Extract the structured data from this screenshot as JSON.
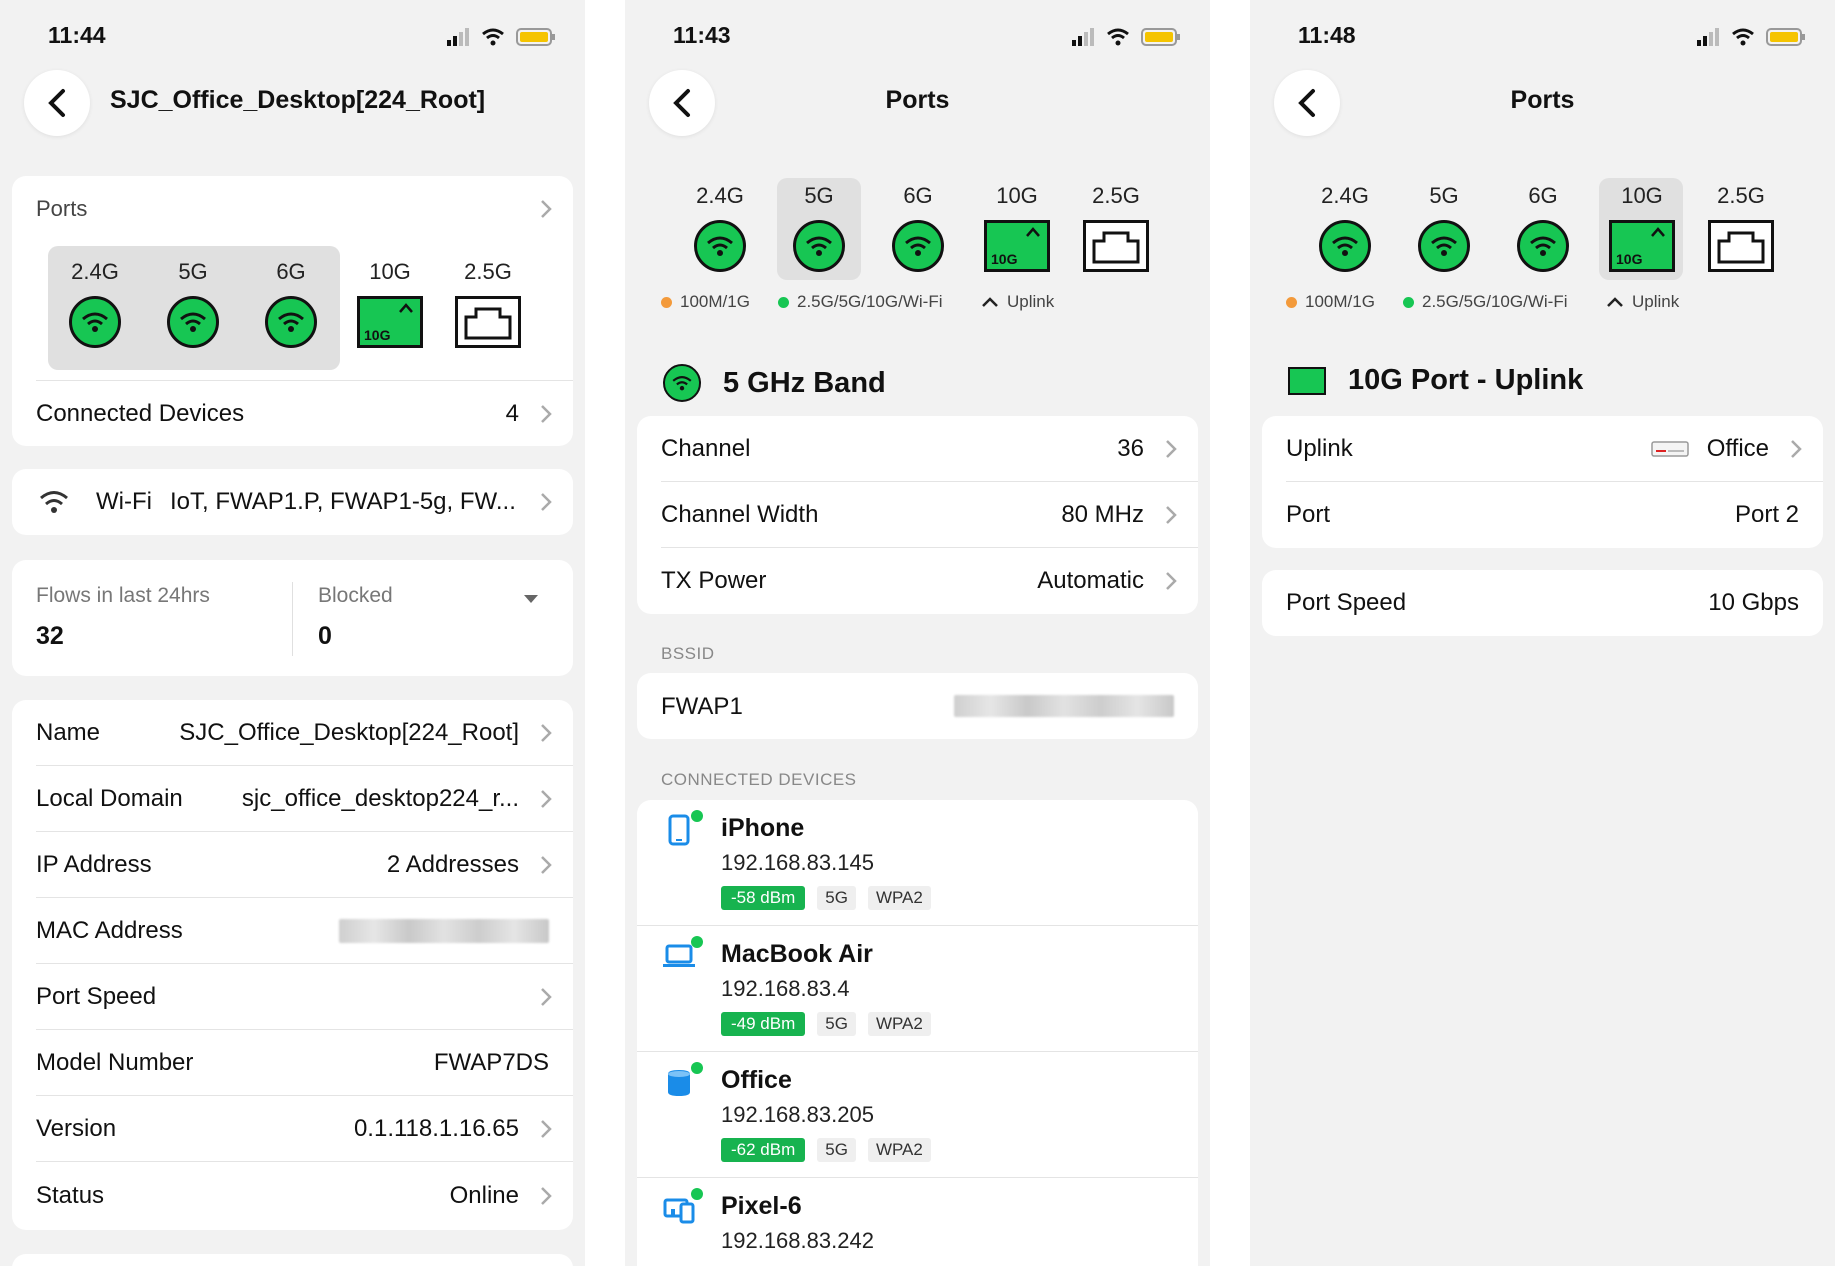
{
  "screen1": {
    "time": "11:44",
    "title": "SJC_Office_Desktop[224_Root]",
    "ports": {
      "label": "Ports",
      "items": [
        "2.4G",
        "5G",
        "6G",
        "10G",
        "2.5G"
      ],
      "badge_10g": "10G"
    },
    "connected_devices": {
      "label": "Connected Devices",
      "value": "4"
    },
    "wifi": {
      "label": "Wi-Fi",
      "value": "IoT, FWAP1.P, FWAP1-5g, FW..."
    },
    "flows": {
      "label": "Flows in last 24hrs",
      "value": "32"
    },
    "blocked": {
      "label": "Blocked",
      "value": "0"
    },
    "details": [
      {
        "label": "Name",
        "value": "SJC_Office_Desktop[224_Root]"
      },
      {
        "label": "Local Domain",
        "value": "sjc_office_desktop224_r..."
      },
      {
        "label": "IP Address",
        "value": "2 Addresses"
      },
      {
        "label": "MAC Address",
        "value": ""
      },
      {
        "label": "Port Speed",
        "value": ""
      },
      {
        "label": "Model Number",
        "value": "FWAP7DS"
      },
      {
        "label": "Version",
        "value": "0.1.118.1.16.65"
      },
      {
        "label": "Status",
        "value": "Online"
      }
    ]
  },
  "screen2": {
    "time": "11:43",
    "title": "Ports",
    "ports": [
      "2.4G",
      "5G",
      "6G",
      "10G",
      "2.5G"
    ],
    "badge_10g": "10G",
    "legend": [
      "100M/1G",
      "2.5G/5G/10G/Wi-Fi",
      "Uplink"
    ],
    "band_title": "5 GHz Band",
    "settings": [
      {
        "label": "Channel",
        "value": "36"
      },
      {
        "label": "Channel Width",
        "value": "80 MHz"
      },
      {
        "label": "TX Power",
        "value": "Automatic"
      }
    ],
    "bssid_header": "BSSID",
    "bssid_name": "FWAP1",
    "devices_header": "CONNECTED DEVICES",
    "devices": [
      {
        "name": "iPhone",
        "ip": "192.168.83.145",
        "signal": "-58 dBm",
        "band": "5G",
        "security": "WPA2",
        "icon": "phone-icon"
      },
      {
        "name": "MacBook Air",
        "ip": "192.168.83.4",
        "signal": "-49 dBm",
        "band": "5G",
        "security": "WPA2",
        "icon": "laptop-icon"
      },
      {
        "name": "Office",
        "ip": "192.168.83.205",
        "signal": "-62 dBm",
        "band": "5G",
        "security": "WPA2",
        "icon": "speaker-icon"
      },
      {
        "name": "Pixel-6",
        "ip": "192.168.83.242",
        "signal": "",
        "band": "",
        "security": "",
        "icon": "devices-icon"
      }
    ]
  },
  "screen3": {
    "time": "11:48",
    "title": "Ports",
    "ports": [
      "2.4G",
      "5G",
      "6G",
      "10G",
      "2.5G"
    ],
    "badge_10g": "10G",
    "legend": [
      "100M/1G",
      "2.5G/5G/10G/Wi-Fi",
      "Uplink"
    ],
    "port_title": "10G Port - Uplink",
    "rows": [
      {
        "label": "Uplink",
        "value": "Office"
      },
      {
        "label": "Port",
        "value": "Port 2"
      }
    ],
    "speed": {
      "label": "Port Speed",
      "value": "10 Gbps"
    }
  },
  "colors": {
    "accent_green": "#17c653",
    "legend_orange": "#f39a3b",
    "legend_green": "#17c653",
    "icon_blue": "#1a8ce8"
  }
}
